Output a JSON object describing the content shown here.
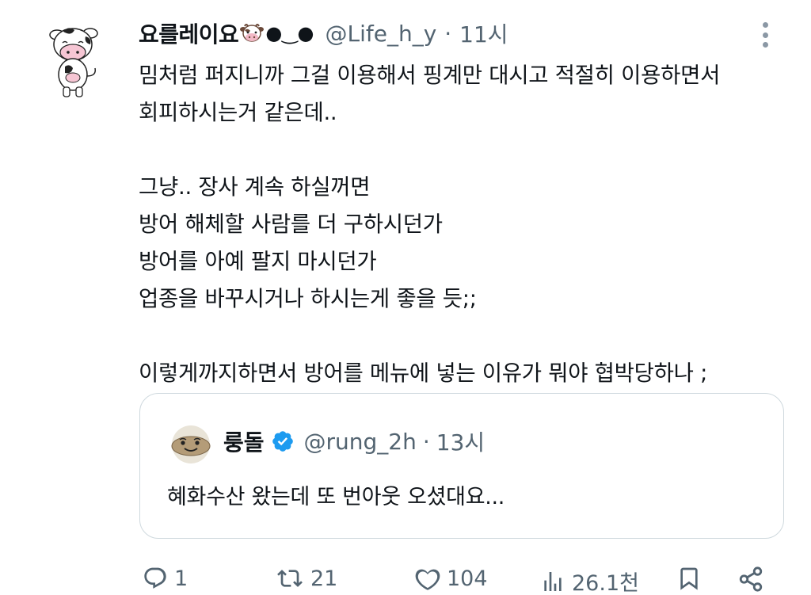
{
  "tweet": {
    "display_name": "요를레이요",
    "name_emoji_suffix": "●‿●",
    "handle": "@Life_h_y",
    "separator": "·",
    "time": "11시",
    "lines": [
      "밈처럼 퍼지니까 그걸 이용해서 핑계만 대시고 적절히 이용하면서",
      "회피하시는거 같은데..",
      "",
      "그냥..  장사 계속 하실꺼면",
      "방어 해체할 사람를 더 구하시던가",
      "방어를 아예 팔지 마시던가",
      "업종을 바꾸시거나 하시는게 좋을 듯;;",
      "",
      "이렇게까지하면서 방어를 메뉴에 넣는 이유가 뭐야 협박당하나 ;"
    ]
  },
  "quote": {
    "display_name": "룽돌",
    "handle": "@rung_2h",
    "separator": "·",
    "time": "13시",
    "text": "혜화수산 왔는데 또 번아웃 오셨대요..."
  },
  "actions": {
    "reply_count": "1",
    "retweet_count": "21",
    "like_count": "104",
    "views_count": "26.1천"
  },
  "colors": {
    "text_primary": "#0f1419",
    "text_secondary": "#536471",
    "verified_blue": "#1d9bf0",
    "border": "#cfd9de"
  },
  "icons": [
    "cow-avatar",
    "cow-emoji-icon",
    "more-icon",
    "verified-badge-icon",
    "reply-icon",
    "retweet-icon",
    "like-icon",
    "views-icon",
    "bookmark-icon",
    "share-icon"
  ]
}
